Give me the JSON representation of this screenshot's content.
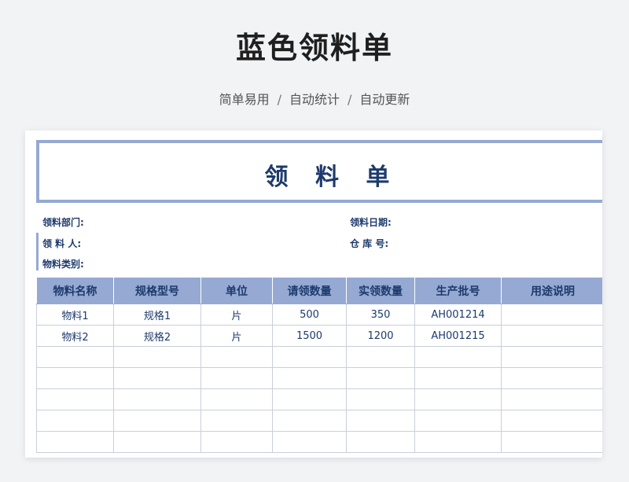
{
  "header": {
    "title": "蓝色领料单",
    "subtitle": [
      "简单易用",
      "自动统计",
      "自动更新"
    ],
    "separator": "/"
  },
  "form": {
    "title": "领 料 单",
    "fields": {
      "dept_label": "领料部门:",
      "date_label": "领料日期:",
      "person_label": "领 料 人:",
      "warehouse_label": "仓 库 号:",
      "category_label": "物料类别:"
    }
  },
  "table": {
    "columns": [
      "物料名称",
      "规格型号",
      "单位",
      "请领数量",
      "实领数量",
      "生产批号",
      "用途说明"
    ],
    "rows": [
      [
        "物料1",
        "规格1",
        "片",
        "500",
        "350",
        "AH001214",
        ""
      ],
      [
        "物料2",
        "规格2",
        "片",
        "1500",
        "1200",
        "AH001215",
        ""
      ],
      [
        "",
        "",
        "",
        "",
        "",
        "",
        ""
      ],
      [
        "",
        "",
        "",
        "",
        "",
        "",
        ""
      ],
      [
        "",
        "",
        "",
        "",
        "",
        "",
        ""
      ],
      [
        "",
        "",
        "",
        "",
        "",
        "",
        ""
      ],
      [
        "",
        "",
        "",
        "",
        "",
        "",
        ""
      ]
    ]
  },
  "colors": {
    "accent": "#95a9d3",
    "text_dark_blue": "#1d3a6c",
    "background": "#f2f3f5"
  }
}
